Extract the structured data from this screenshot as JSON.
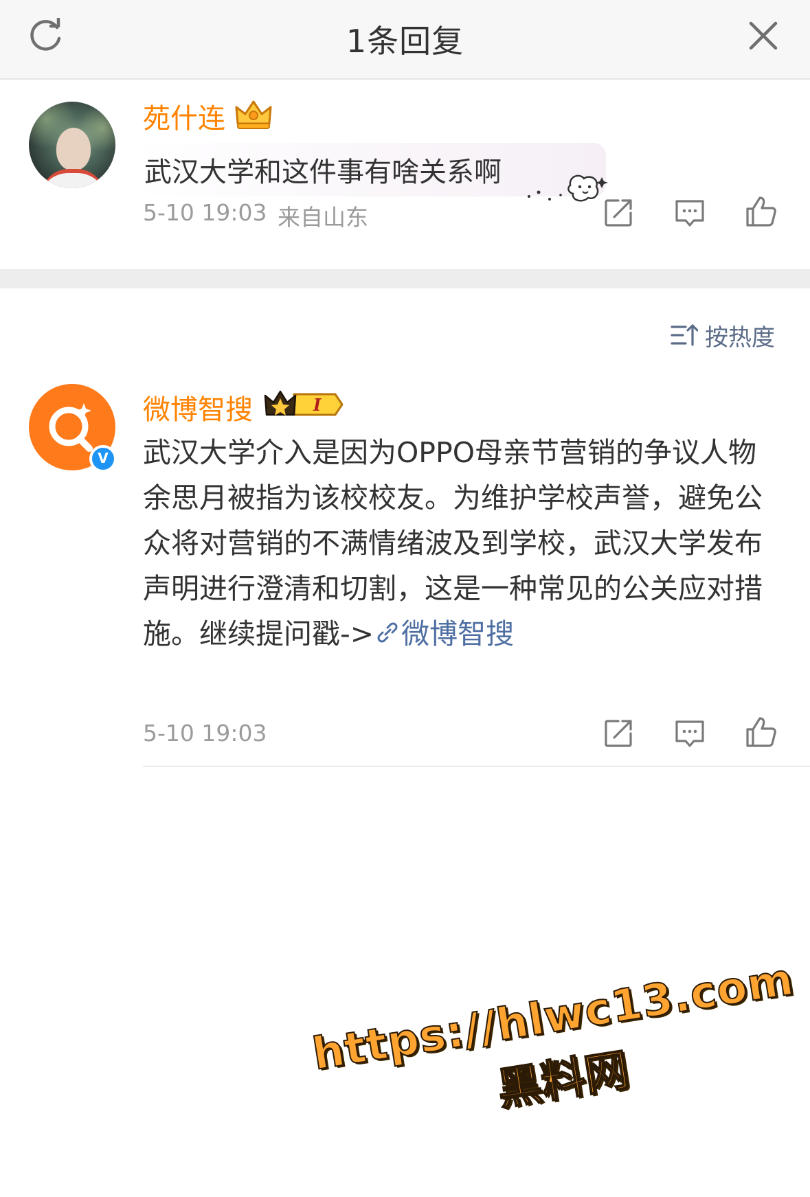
{
  "header": {
    "title": "1条回复",
    "refresh_icon": "refresh-icon",
    "close_icon": "close-icon"
  },
  "root_comment": {
    "username": "苑什连",
    "badge_icon": "crown-badge-icon",
    "text": "武汉大学和这件事有啥关系啊",
    "sticker_icon": "bubble-sticker-icon",
    "time": "5-10 19:03",
    "location": "来自山东",
    "actions": [
      "share-icon",
      "comment-icon",
      "like-icon"
    ]
  },
  "sort": {
    "label": "按热度",
    "icon": "sort-icon"
  },
  "reply": {
    "username": "微博智搜",
    "badge_icon": "crown-level-badge-icon",
    "badge_level": "I",
    "verified_mark": "V",
    "text": "武汉大学介入是因为OPPO母亲节营销的争议人物余思月被指为该校校友。为维护学校声誉，避免公众将对营销的不满情绪波及到学校，武汉大学发布声明进行澄清和切割，这是一种常见的公关应对措施。继续提问戳->",
    "link_icon": "link-icon",
    "link_text": "微博智搜",
    "time": "5-10 19:03",
    "actions": [
      "share-icon",
      "comment-icon",
      "like-icon"
    ]
  },
  "watermark": {
    "url": "https://hlwc13.com",
    "name": "黑料网"
  },
  "colors": {
    "username": "#ff8200",
    "link": "#4f6fa3",
    "meta": "#9b9b9b",
    "verified": "#1e94f4",
    "brand_orange": "#ff7a1a"
  }
}
